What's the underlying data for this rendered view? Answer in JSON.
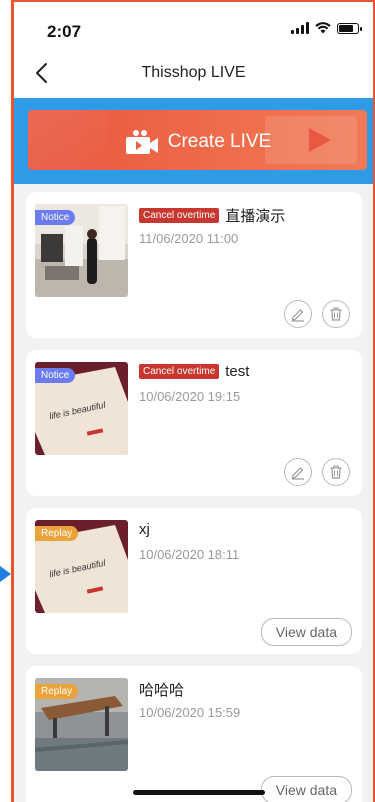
{
  "status_bar": {
    "time": "2:07"
  },
  "nav": {
    "title": "Thisshop LIVE"
  },
  "banner": {
    "label": "Create LIVE"
  },
  "lives": [
    {
      "badge": "Notice",
      "tag": "Cancel overtime",
      "title": "直播演示",
      "date": "11/06/2020 11:00",
      "actions": [
        "edit",
        "delete"
      ]
    },
    {
      "badge": "Notice",
      "tag": "Cancel overtime",
      "title": "test",
      "date": "10/06/2020 19:15",
      "actions": [
        "edit",
        "delete"
      ]
    },
    {
      "badge": "Replay",
      "tag": "",
      "title": "xj",
      "date": "10/06/2020 18:11",
      "action_label": "View data"
    },
    {
      "badge": "Replay",
      "tag": "",
      "title": "哈哈哈",
      "date": "10/06/2020 15:59",
      "action_label": "View data"
    }
  ],
  "colors": {
    "accent": "#e8552f",
    "banner_bg": "#2f9ae6",
    "tag": "#c8372f",
    "notice_badge": "#6b7cf0",
    "replay_badge": "#eaa23b"
  }
}
